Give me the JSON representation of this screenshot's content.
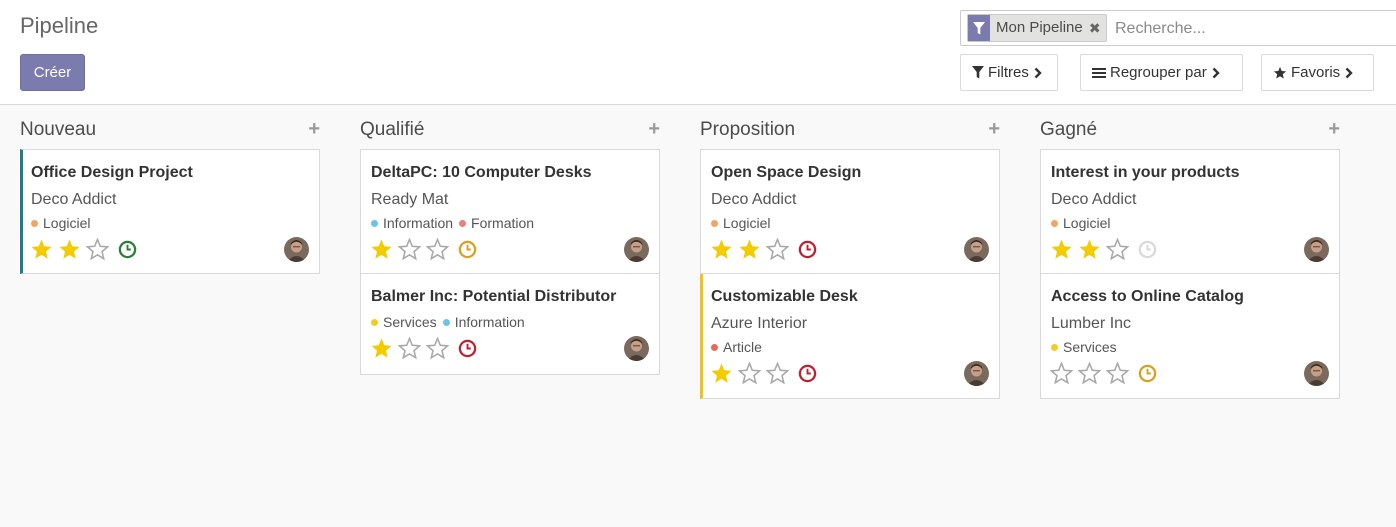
{
  "header": {
    "title": "Pipeline",
    "create_label": "Créer"
  },
  "search": {
    "facet_label": "Mon Pipeline",
    "facet_remove": "✖",
    "placeholder": "Recherche..."
  },
  "toolbar": {
    "filters_label": "Filtres",
    "groupby_label": "Regrouper par",
    "favorites_label": "Favoris"
  },
  "colors": {
    "accent": "#7c7bad",
    "star_on": "#f3cc00",
    "star_off": "#a8a8a8",
    "clock_green": "#2c7d35",
    "clock_orange": "#d9a01f",
    "clock_red": "#bd2130",
    "clock_grey": "#d9d9d9",
    "tag_orange": "#f4a460",
    "tag_blue": "#6cc1ed",
    "tag_red": "#ef7b7b",
    "tag_yellow": "#f3cc23",
    "tag_crimson": "#e46a5a"
  },
  "columns": [
    {
      "title": "Nouveau",
      "add": "+",
      "cards": [
        {
          "title": "Office Design Project",
          "company": "Deco Addict",
          "tags": [
            {
              "label": "Logiciel",
              "color": "#f4a460"
            }
          ],
          "priority": 2,
          "activity": "green",
          "marker": "teal"
        }
      ]
    },
    {
      "title": "Qualifié",
      "add": "+",
      "cards": [
        {
          "title": "DeltaPC: 10 Computer Desks",
          "company": "Ready Mat",
          "tags": [
            {
              "label": "Information",
              "color": "#6cc1ed"
            },
            {
              "label": "Formation",
              "color": "#ef7b7b"
            }
          ],
          "priority": 1,
          "activity": "orange"
        },
        {
          "title": "Balmer Inc: Potential Distributor",
          "company": "",
          "tags": [
            {
              "label": "Services",
              "color": "#f3cc23"
            },
            {
              "label": "Information",
              "color": "#6cc1ed"
            }
          ],
          "priority": 1,
          "activity": "red"
        }
      ]
    },
    {
      "title": "Proposition",
      "add": "+",
      "cards": [
        {
          "title": "Open Space Design",
          "company": "Deco Addict",
          "tags": [
            {
              "label": "Logiciel",
              "color": "#f4a460"
            }
          ],
          "priority": 2,
          "activity": "red"
        },
        {
          "title": "Customizable Desk",
          "company": "Azure Interior",
          "tags": [
            {
              "label": "Article",
              "color": "#e46a5a"
            }
          ],
          "priority": 1,
          "activity": "red",
          "marker": "yellow"
        }
      ]
    },
    {
      "title": "Gagné",
      "add": "+",
      "cards": [
        {
          "title": "Interest in your products",
          "company": "Deco Addict",
          "tags": [
            {
              "label": "Logiciel",
              "color": "#f4a460"
            }
          ],
          "priority": 2,
          "activity": "grey"
        },
        {
          "title": "Access to Online Catalog",
          "company": "Lumber Inc",
          "tags": [
            {
              "label": "Services",
              "color": "#f3cc23"
            }
          ],
          "priority": 0,
          "activity": "orange"
        }
      ]
    }
  ]
}
